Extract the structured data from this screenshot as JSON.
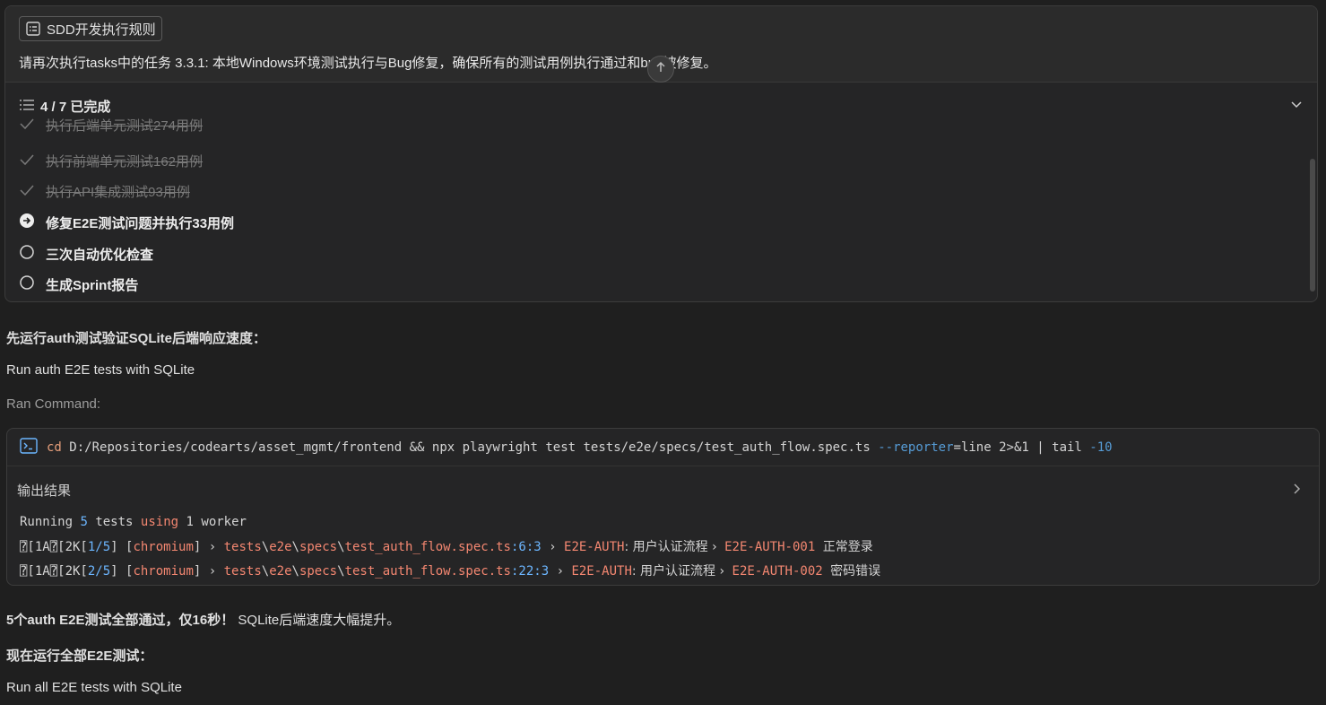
{
  "header": {
    "rule_chip_label": "SDD开发执行规则",
    "prompt_text": "请再次执行tasks中的任务 3.3.1: 本地Windows环境测试执行与Bug修复，确保所有的测试用例执行通过和bug被修复。"
  },
  "progress": {
    "label": "4 / 7 已完成",
    "completed": 4,
    "total": 7
  },
  "tasks": [
    {
      "label": "执行后端单元测试274用例",
      "status": "done"
    },
    {
      "label": "执行前端单元测试162用例",
      "status": "done"
    },
    {
      "label": "执行API集成测试93用例",
      "status": "done"
    },
    {
      "label": "修复E2E测试问题并执行33用例",
      "status": "current"
    },
    {
      "label": "三次自动优化检查",
      "status": "pending"
    },
    {
      "label": "生成Sprint报告",
      "status": "pending"
    }
  ],
  "messages": {
    "intro": "先运行auth测试验证SQLite后端响应速度：",
    "step_title": "Run auth E2E tests with SQLite",
    "ran_command_label": "Ran Command:",
    "result_bold": "5个auth E2E测试全部通过，仅16秒！",
    "result_normal": "SQLite后端速度大幅提升。",
    "next_intro": "现在运行全部E2E测试：",
    "next_step_title": "Run all E2E tests with SQLite"
  },
  "command": {
    "cd": "cd",
    "path": "D:/Repositories/codearts/asset_mgmt/frontend",
    "and": "&&",
    "npx": "npx playwright test tests/e2e/specs/test_auth_flow.spec.ts",
    "flag": "--reporter",
    "flag_val": "=line",
    "redir": "2>&1",
    "pipe": "|",
    "tail": "tail",
    "tail_arg": "-10"
  },
  "output": {
    "header_label": "输出结果",
    "line1": {
      "a": "Running",
      "b": "5",
      "c": "tests",
      "d": "using",
      "e": "1",
      "f": "worker"
    },
    "line2": {
      "esc": "⍰[1A⍰[2K[",
      "count": "1/5",
      "bracket_close": "] [",
      "browser": "chromium",
      "close": "] ›",
      "path1": "tests",
      "path2": "e2e",
      "path3": "specs",
      "path4": "test_auth_flow.spec.ts",
      "loc": ":6:3",
      "arrow": "›",
      "suite": "E2E-AUTH",
      "suite_name": ": 用户认证流程 ›",
      "case_id": "E2E-AUTH-001",
      "case_name": "正常登录"
    },
    "line3": {
      "esc": "⍰[1A⍰[2K[",
      "count": "2/5",
      "bracket_close": "] [",
      "browser": "chromium",
      "close": "] ›",
      "path1": "tests",
      "path2": "e2e",
      "path3": "specs",
      "path4": "test_auth_flow.spec.ts",
      "loc": ":22:3",
      "arrow": "›",
      "suite": "E2E-AUTH",
      "suite_name": ": 用户认证流程 ›",
      "case_id": "E2E-AUTH-002",
      "case_name": "密码错误"
    }
  }
}
